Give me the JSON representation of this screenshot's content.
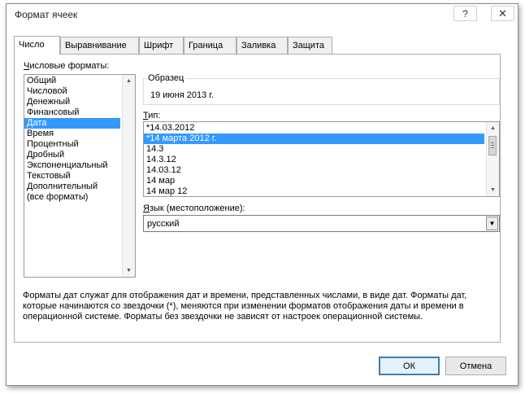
{
  "window": {
    "title": "Формат ячеек",
    "help_label": "?",
    "close_label": "✕"
  },
  "tabs": [
    {
      "label": "Число",
      "active": true
    },
    {
      "label": "Выравнивание",
      "active": false
    },
    {
      "label": "Шрифт",
      "active": false
    },
    {
      "label": "Граница",
      "active": false
    },
    {
      "label": "Заливка",
      "active": false
    },
    {
      "label": "Защита",
      "active": false
    }
  ],
  "number_formats": {
    "label_first": "Ч",
    "label_rest": "исловые форматы:",
    "items": [
      "Общий",
      "Числовой",
      "Денежный",
      "Финансовый",
      "Дата",
      "Время",
      "Процентный",
      "Дробный",
      "Экспоненциальный",
      "Текстовый",
      "Дополнительный",
      "(все форматы)"
    ],
    "selected_index": 4
  },
  "sample": {
    "label": "Образец",
    "value": "19 июня 2013 г."
  },
  "type": {
    "label_first": "Т",
    "label_rest": "ип:",
    "items": [
      "*14.03.2012",
      "*14 марта 2012 г.",
      "14.3",
      "14.3.12",
      "14.03.12",
      "14 мар",
      "14 мар 12"
    ],
    "selected_index": 1
  },
  "locale": {
    "label_first": "Я",
    "label_rest": "зык (местоположение):",
    "value": "русский"
  },
  "description": "Форматы дат служат для отображения дат и времени, представленных числами, в виде дат. Форматы дат, которые начинаются со звездочки (*), меняются при изменении форматов отображения даты и времени в операционной системе. Форматы без звездочки не зависят от настроек операционной системы.",
  "buttons": {
    "ok": "ОК",
    "cancel": "Отмена"
  }
}
